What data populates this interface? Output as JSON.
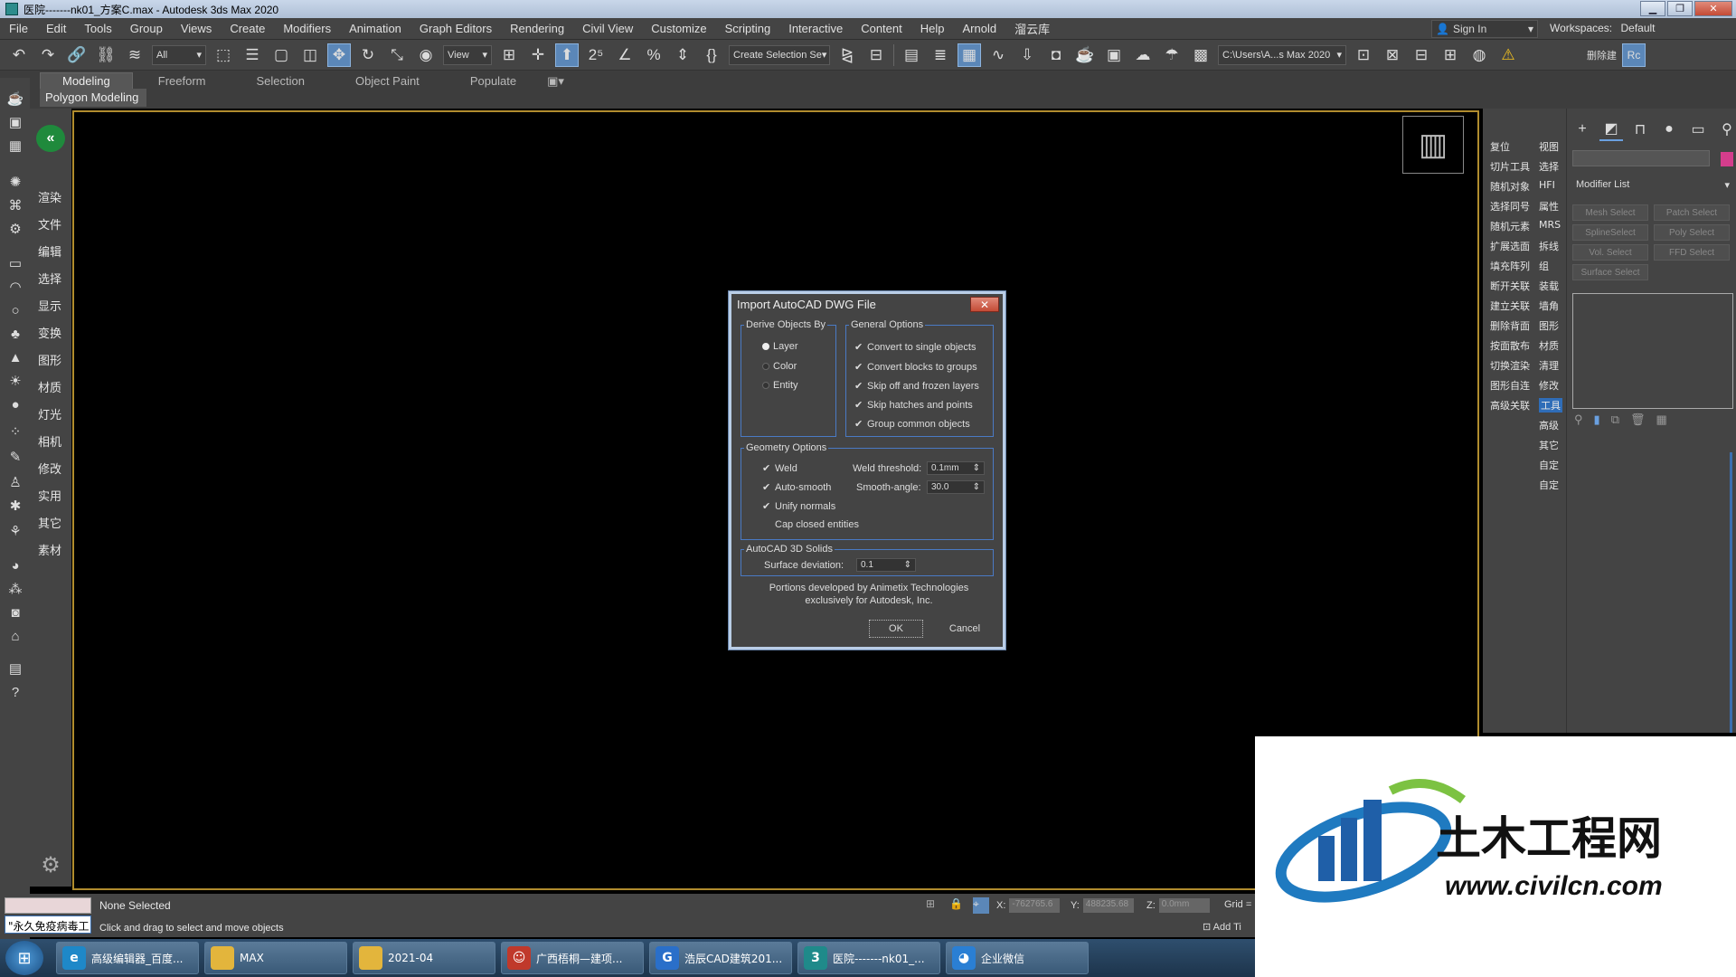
{
  "window": {
    "title": "医院-------nk01_方案C.max - Autodesk 3ds Max 2020",
    "min": "▁",
    "restore": "❐",
    "close": "✕"
  },
  "menu": {
    "items": [
      "File",
      "Edit",
      "Tools",
      "Group",
      "Views",
      "Create",
      "Modifiers",
      "Animation",
      "Graph Editors",
      "Rendering",
      "Civil View",
      "Customize",
      "Scripting",
      "Interactive",
      "Content",
      "Help",
      "Arnold",
      "溜云库"
    ],
    "sign_in": "Sign In",
    "workspace_label": "Workspaces:",
    "workspace_value": "Default"
  },
  "toolbar": {
    "filter": "All",
    "ref_coord": "View",
    "selection_set": "Create Selection Se",
    "project_path": "C:\\Users\\A...s Max 2020",
    "right_label": "删除建"
  },
  "ribbon": {
    "tabs": [
      "Modeling",
      "Freeform",
      "Selection",
      "Object Paint",
      "Populate"
    ],
    "sub": "Polygon Modeling"
  },
  "left_panel": {
    "items": [
      "渲染",
      "文件",
      "编辑",
      "选择",
      "显示",
      "变换",
      "图形",
      "材质",
      "灯光",
      "相机",
      "修改",
      "实用",
      "其它",
      "素材"
    ]
  },
  "dialog": {
    "title": "Import AutoCAD DWG File",
    "close": "✕",
    "derive_label": "Derive Objects By",
    "derive_options": [
      {
        "label": "Layer",
        "selected": true
      },
      {
        "label": "Color",
        "selected": false
      },
      {
        "label": "Entity",
        "selected": false
      }
    ],
    "general_label": "General Options",
    "general_options": [
      {
        "label": "Convert to single objects",
        "checked": true
      },
      {
        "label": "Convert blocks to groups",
        "checked": true
      },
      {
        "label": "Skip off and frozen layers",
        "checked": true
      },
      {
        "label": "Skip hatches and points",
        "checked": true
      },
      {
        "label": "Group common objects",
        "checked": true
      }
    ],
    "geometry_label": "Geometry Options",
    "weld": "Weld",
    "auto_smooth": "Auto-smooth",
    "unify_normals": "Unify normals",
    "cap_closed": "Cap closed entities",
    "weld_threshold_label": "Weld threshold:",
    "weld_threshold_value": "0.1mm",
    "smooth_angle_label": "Smooth-angle:",
    "smooth_angle_value": "30.0",
    "solids_label": "AutoCAD 3D Solids",
    "surface_deviation_label": "Surface deviation:",
    "surface_deviation_value": "0.1",
    "credit_line1": "Portions developed by Animetix Technologies",
    "credit_line2": "exclusively for Autodesk, Inc.",
    "ok": "OK",
    "cancel": "Cancel"
  },
  "right_tools": {
    "col1": [
      "复位",
      "切片工具",
      "随机对象",
      "选择同号",
      "随机元素",
      "扩展选面",
      "填充阵列",
      "断开关联",
      "建立关联",
      "删除背面",
      "按面散布",
      "切换渲染",
      "图形自连",
      "高级关联"
    ],
    "col2": [
      "视图",
      "选择",
      "HFI",
      "属性",
      "MRS",
      "拆线",
      "组",
      "装载",
      "墙角",
      "图形",
      "材质",
      "清理",
      "修改",
      "工具",
      "高级",
      "其它",
      "自定",
      "自定"
    ],
    "active": "工具"
  },
  "command_panel": {
    "modifier_list": "Modifier List",
    "buttons": [
      "Mesh Select",
      "Patch Select",
      "SplineSelect",
      "Poly Select",
      "Vol. Select",
      "FFD Select",
      "Surface Select"
    ]
  },
  "status": {
    "script_tag": "\"永久免疫病毒工",
    "selection": "None Selected",
    "prompt": "Click and drag to select and move objects",
    "x_label": "X:",
    "x_value": "-762765.6",
    "y_label": "Y:",
    "y_value": "488235.68",
    "z_label": "Z:",
    "z_value": "0.0mm",
    "grid": "Grid =",
    "add_time": "Add Ti"
  },
  "taskbar": {
    "items": [
      {
        "label": "高级编辑器_百度...",
        "icon": "edge-icon",
        "color": "#1e88c8"
      },
      {
        "label": "MAX",
        "icon": "folder-icon",
        "color": "#e3b53c"
      },
      {
        "label": "2021-04",
        "icon": "folder-icon",
        "color": "#e3b53c"
      },
      {
        "label": "广西梧桐—建项...",
        "icon": "app-icon",
        "color": "#c0392b"
      },
      {
        "label": "浩辰CAD建筑201...",
        "icon": "cad-icon",
        "color": "#2a6fc9"
      },
      {
        "label": "医院-------nk01_...",
        "icon": "max-icon",
        "color": "#1f8a8a"
      },
      {
        "label": "企业微信",
        "icon": "wechat-icon",
        "color": "#2a7fd4"
      }
    ]
  },
  "watermark": {
    "cn": "土木工程网",
    "url": "www.civilcn.com"
  },
  "colors": {
    "accent": "#5b87b8",
    "viewport_border": "#b08c2e",
    "group_border": "#4a7ac4"
  }
}
